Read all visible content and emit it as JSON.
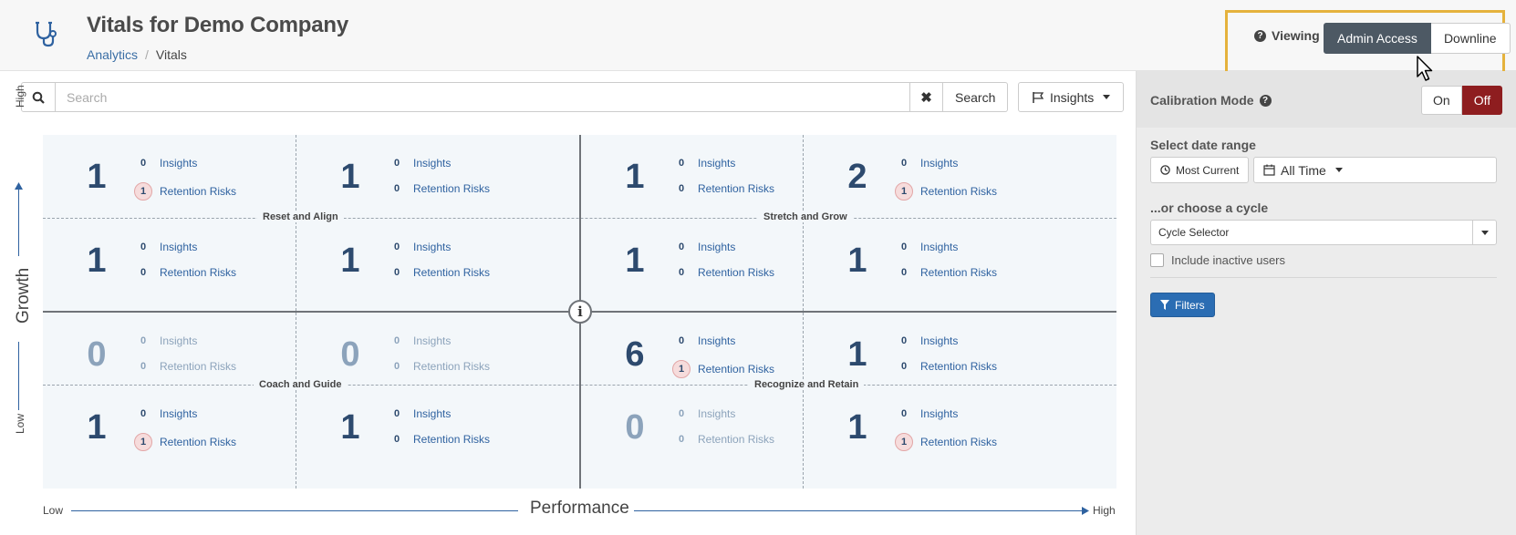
{
  "header": {
    "title": "Vitals for Demo Company",
    "breadcrumb": {
      "parent": "Analytics",
      "separator": "/",
      "current": "Vitals"
    },
    "viewing": {
      "label": "Viewing",
      "options": [
        "Admin Access",
        "Downline"
      ],
      "selected": "Admin Access"
    }
  },
  "search": {
    "placeholder": "Search",
    "value": "",
    "clear_icon": "✖",
    "button": "Search"
  },
  "insights_filter": {
    "label": "Insights"
  },
  "grid": {
    "center_icon": "i",
    "quadrant_labels": {
      "top_left": "Reset and Align",
      "top_right": "Stretch and Grow",
      "bottom_left": "Coach and Guide",
      "bottom_right": "Recognize and Retain"
    },
    "insights_label": "Insights",
    "risks_label": "Retention Risks",
    "cells": [
      {
        "count": "1",
        "insights": "0",
        "risks": "1"
      },
      {
        "count": "1",
        "insights": "0",
        "risks": "0"
      },
      {
        "count": "1",
        "insights": "0",
        "risks": "0"
      },
      {
        "count": "2",
        "insights": "0",
        "risks": "1"
      },
      {
        "count": "1",
        "insights": "0",
        "risks": "0"
      },
      {
        "count": "1",
        "insights": "0",
        "risks": "0"
      },
      {
        "count": "1",
        "insights": "0",
        "risks": "0"
      },
      {
        "count": "1",
        "insights": "0",
        "risks": "0"
      },
      {
        "count": "0",
        "insights": "0",
        "risks": "0"
      },
      {
        "count": "0",
        "insights": "0",
        "risks": "0"
      },
      {
        "count": "6",
        "insights": "0",
        "risks": "1"
      },
      {
        "count": "1",
        "insights": "0",
        "risks": "0"
      },
      {
        "count": "1",
        "insights": "0",
        "risks": "1"
      },
      {
        "count": "1",
        "insights": "0",
        "risks": "0"
      },
      {
        "count": "0",
        "insights": "0",
        "risks": "0"
      },
      {
        "count": "1",
        "insights": "0",
        "risks": "1"
      }
    ]
  },
  "axes": {
    "y_title": "Growth",
    "y_high": "High",
    "y_low": "Low",
    "x_title": "Performance",
    "x_high": "High",
    "x_low": "Low"
  },
  "panel": {
    "calibration": {
      "label": "Calibration Mode",
      "on": "On",
      "off": "Off",
      "selected": "Off"
    },
    "date_range": {
      "label": "Select date range",
      "most_current": "Most Current",
      "all_time": "All Time"
    },
    "cycle": {
      "label": "...or choose a cycle",
      "value": "Cycle Selector"
    },
    "inactive": {
      "label": "Include inactive users",
      "checked": false
    },
    "filters_button": "Filters"
  },
  "colors": {
    "accent": "#2b6db3",
    "off_active": "#8e1d1f",
    "highlight_border": "#e5b23c",
    "count_color": "#2d4a6e"
  }
}
